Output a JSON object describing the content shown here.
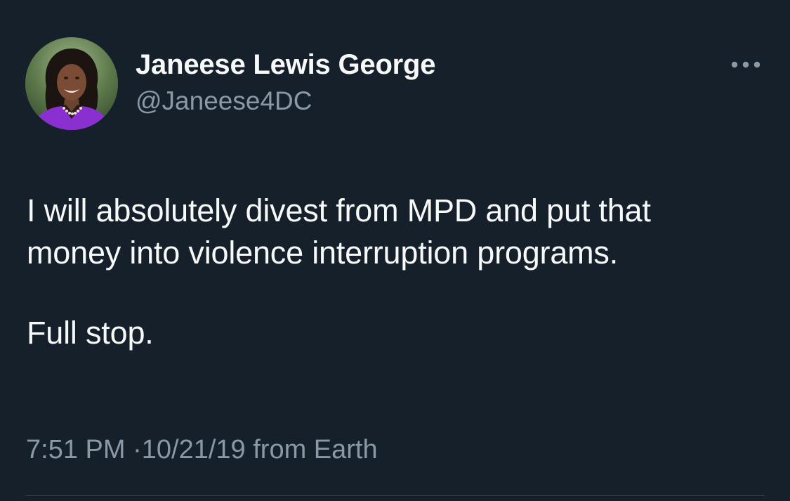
{
  "tweet": {
    "author": {
      "display_name": "Janeese Lewis George",
      "handle": "@Janeese4DC",
      "avatar_icon": "profile-photo"
    },
    "more_icon": "more-horizontal-icon",
    "text_lines": [
      "I will absolutely divest from MPD and put that",
      "money into violence interruption programs."
    ],
    "text_para2": "Full stop.",
    "time": "7:51 PM",
    "separator": "·",
    "date": "10/21/19",
    "source": "from Earth"
  },
  "colors": {
    "background": "#15202b",
    "primary_text": "#f7f9f9",
    "secondary_text": "#8b98a5",
    "divider": "#38444d"
  }
}
